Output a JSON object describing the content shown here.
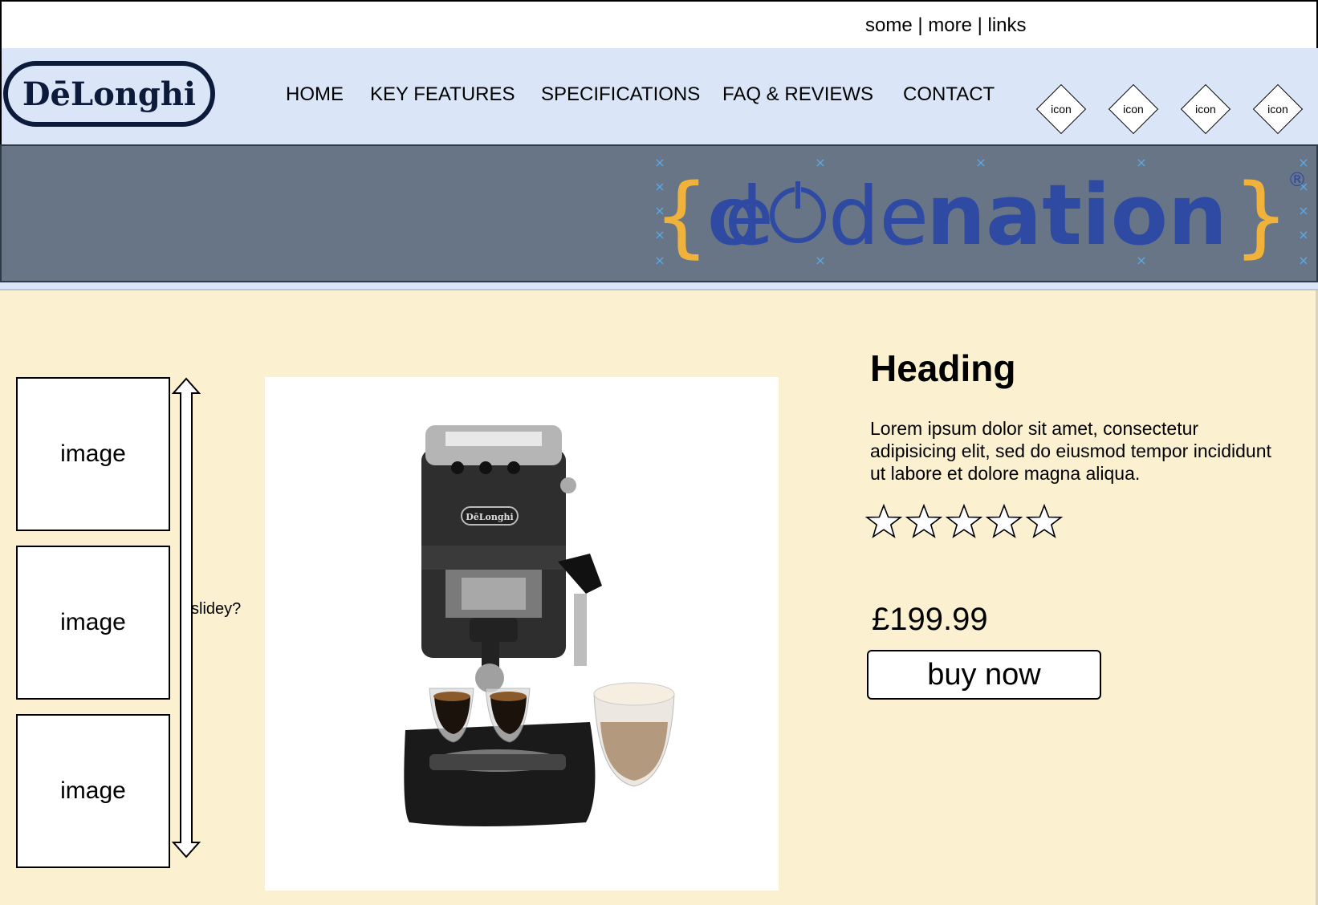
{
  "top_bar": {
    "links_text": "some | more | links"
  },
  "brand": {
    "name": "DēLonghi"
  },
  "nav": {
    "items": [
      "HOME",
      "KEY FEATURES",
      "SPECIFICATIONS",
      "FAQ & REVIEWS",
      "CONTACT"
    ],
    "icons": [
      "icon",
      "icon",
      "icon",
      "icon"
    ]
  },
  "banner": {
    "logo_part1": "{",
    "logo_part2": "cde",
    "logo_part3": "nation",
    "logo_part4": "}",
    "registered_mark": "®",
    "colors": {
      "background": "#687586",
      "logo_blue": "#2f4aa2",
      "logo_bracket": "#f0b23b"
    }
  },
  "gallery": {
    "thumbnails": [
      "image",
      "image",
      "image"
    ],
    "slider_label": "slidey?"
  },
  "product": {
    "heading": "Heading",
    "description": "Lorem ipsum dolor sit amet, consectetur adipisicing elit, sed do eiusmod tempor incididunt ut labore et dolore magna aliqua.",
    "rating": {
      "stars_total": 5,
      "stars_filled": 0
    },
    "price": "£199.99",
    "buy_label": "buy now",
    "product_brand_label": "DēLonghi"
  },
  "colors": {
    "header_bg": "#dae6f8",
    "main_bg": "#fbf0cf"
  }
}
